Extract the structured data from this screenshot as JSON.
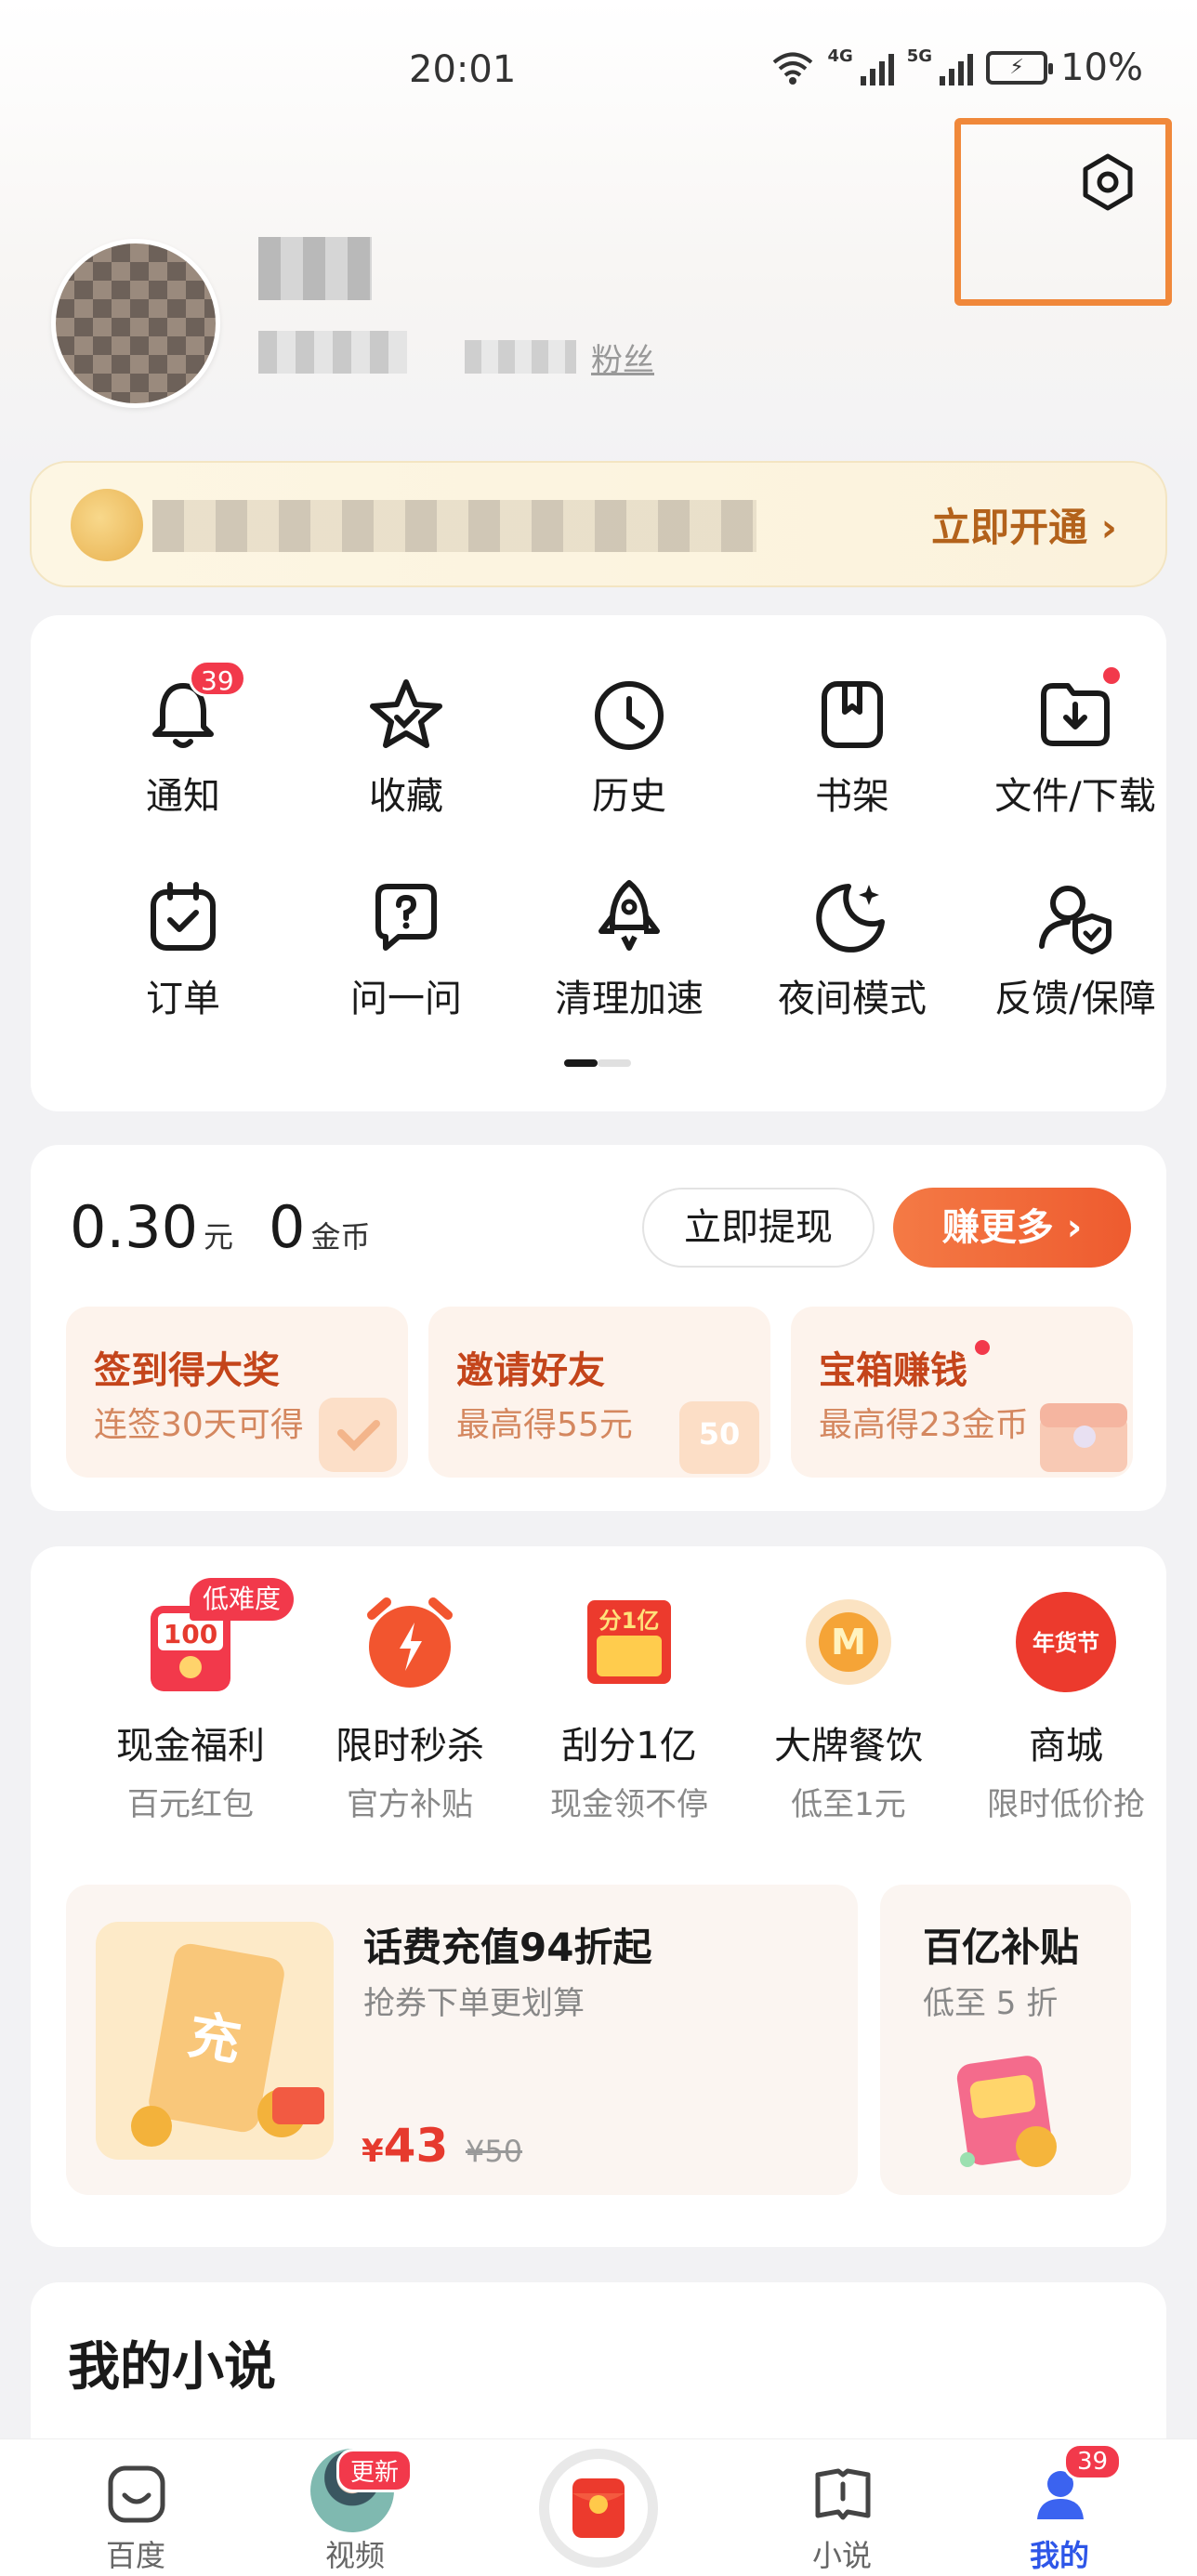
{
  "status_bar": {
    "time": "20:01",
    "net1": "4G",
    "net2": "5G",
    "battery": "10%"
  },
  "profile": {
    "fans_label": "粉丝"
  },
  "vip": {
    "cta": "立即开通 ›"
  },
  "tools": [
    {
      "label": "通知",
      "icon": "bell-icon",
      "badge": "39"
    },
    {
      "label": "收藏",
      "icon": "star-icon"
    },
    {
      "label": "历史",
      "icon": "clock-icon"
    },
    {
      "label": "书架",
      "icon": "bookshelf-icon"
    },
    {
      "label": "文件/下载",
      "icon": "download-icon",
      "dot": true
    },
    {
      "label": "订单",
      "icon": "order-icon"
    },
    {
      "label": "问一问",
      "icon": "question-icon"
    },
    {
      "label": "清理加速",
      "icon": "rocket-icon"
    },
    {
      "label": "夜间模式",
      "icon": "moon-icon"
    },
    {
      "label": "反馈/保障",
      "icon": "feedback-shield-icon"
    }
  ],
  "wallet": {
    "cash": "0.30",
    "cash_unit": "元",
    "coins": "0",
    "coins_unit": "金币",
    "withdraw_label": "立即提现",
    "earn_label": "赚更多 ›",
    "tasks": [
      {
        "title": "签到得大奖",
        "desc": "连签30天可得"
      },
      {
        "title": "邀请好友",
        "desc": "最高得55元"
      },
      {
        "title": "宝箱赚钱",
        "desc": "最高得23金币"
      }
    ]
  },
  "shop": {
    "items": [
      {
        "title": "现金福利",
        "desc": "百元红包",
        "tag": "低难度",
        "icon_text": "100"
      },
      {
        "title": "限时秒杀",
        "desc": "官方补贴"
      },
      {
        "title": "刮分1亿",
        "desc": "现金领不停",
        "icon_text": "分1亿"
      },
      {
        "title": "大牌餐饮",
        "desc": "低至1元",
        "icon_text": "M"
      },
      {
        "title": "商城",
        "desc": "限时低价抢",
        "icon_text": "年货节"
      }
    ],
    "promo1": {
      "title": "话费充值94折起",
      "desc": "抢券下单更划算",
      "price_symbol": "¥",
      "price": "43",
      "old_price": "¥50",
      "icon_text": "充"
    },
    "promo2": {
      "title": "百亿补贴",
      "desc": "低至 5 折"
    }
  },
  "novel": {
    "title": "我的小说"
  },
  "bottom_nav": {
    "home": "百度",
    "video": "视频",
    "video_badge": "更新",
    "novel": "小说",
    "mine": "我的",
    "mine_badge": "39"
  },
  "colors": {
    "accent": "#f2394b",
    "orange": "#ee5b2f",
    "highlight_box": "#f0883a"
  }
}
